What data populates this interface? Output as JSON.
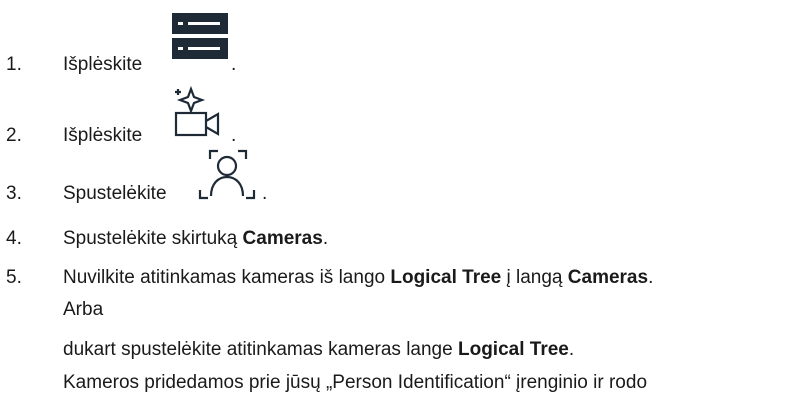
{
  "steps": [
    {
      "num": "1.",
      "text": "Išplėskite",
      "end": ".",
      "icon": "server-icon"
    },
    {
      "num": "2.",
      "text": "Išplėskite",
      "end": ".",
      "icon": "ai-camera-icon"
    },
    {
      "num": "3.",
      "text": "Spustelėkite",
      "end": ".",
      "icon": "person-identification-icon"
    },
    {
      "num": "4.",
      "pre": "Spustelėkite skirtuką ",
      "bold": "Cameras",
      "post": "."
    },
    {
      "num": "5.",
      "pre": "Nuvilkite atitinkamas kameras iš lango ",
      "bold1": "Logical Tree",
      "mid": " į langą ",
      "bold2": "Cameras",
      "post": "."
    }
  ],
  "alternative": "Arba",
  "alt_line": {
    "pre": "dukart spustelėkite atitinkamas kameras lange ",
    "bold": "Logical Tree",
    "post": "."
  },
  "result_line": "Kameros pridedamos prie jūsų „Person Identification“ įrenginio ir rodo"
}
